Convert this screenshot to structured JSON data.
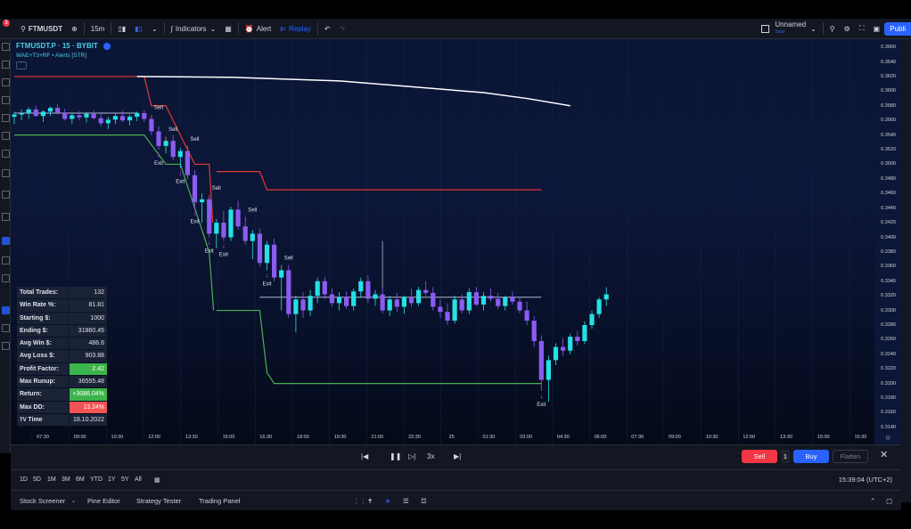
{
  "toolbar": {
    "notification_count": "3",
    "symbol": "FTMUSDT",
    "interval": "15m",
    "indicators_label": "Indicators",
    "alert_label": "Alert",
    "replay_label": "Replay",
    "layout_name": "Unnamed",
    "layout_status": "Save",
    "publish_label": "Publi"
  },
  "legend": {
    "title": "FTMUSDT.P · 15 · BYBIT",
    "indicator": "WAE+T3+RF • Alerts [STR]"
  },
  "colors": {
    "bull": "#26e0e6",
    "bear": "#8a5cf0",
    "upper_band": "#e53935",
    "lower_band": "#4caf50",
    "long_ma": "#ffffff",
    "signal": "#e040fb",
    "accent": "#2962ff"
  },
  "price_axis": [
    "0.3660",
    "0.3640",
    "0.3620",
    "0.3600",
    "0.3580",
    "0.3560",
    "0.3540",
    "0.3520",
    "0.3500",
    "0.3480",
    "0.3460",
    "0.3440",
    "0.3420",
    "0.3400",
    "0.3380",
    "0.3360",
    "0.3340",
    "0.3320",
    "0.3300",
    "0.3280",
    "0.3260",
    "0.3240",
    "0.3220",
    "0.3200",
    "0.3180",
    "0.3160",
    "0.3140"
  ],
  "time_axis": [
    "07:30",
    "09:00",
    "10:30",
    "12:00",
    "13:30",
    "15:00",
    "16:30",
    "18:00",
    "19:30",
    "21:00",
    "22:30",
    "25",
    "01:30",
    "03:00",
    "04:30",
    "06:00",
    "07:30",
    "09:00",
    "10:30",
    "12:00",
    "13:30",
    "15:00",
    "16:30"
  ],
  "chart_data": {
    "type": "candlestick",
    "ylim": [
      0.3135,
      0.3665
    ],
    "candles_note": "15m candles, open/high/low/close in USDT",
    "candles": [
      [
        0.3565,
        0.3572,
        0.3555,
        0.3568
      ],
      [
        0.3568,
        0.3575,
        0.356,
        0.357
      ],
      [
        0.357,
        0.3578,
        0.3562,
        0.3575
      ],
      [
        0.3575,
        0.358,
        0.3565,
        0.3566
      ],
      [
        0.3566,
        0.3574,
        0.3558,
        0.3572
      ],
      [
        0.3572,
        0.3579,
        0.3566,
        0.3577
      ],
      [
        0.3577,
        0.3582,
        0.3568,
        0.357
      ],
      [
        0.357,
        0.3576,
        0.356,
        0.3562
      ],
      [
        0.3562,
        0.357,
        0.3555,
        0.3567
      ],
      [
        0.3567,
        0.3573,
        0.356,
        0.3564
      ],
      [
        0.3564,
        0.3571,
        0.3557,
        0.3569
      ],
      [
        0.3569,
        0.3574,
        0.3561,
        0.3563
      ],
      [
        0.3563,
        0.357,
        0.3552,
        0.3556
      ],
      [
        0.3556,
        0.3565,
        0.3548,
        0.3561
      ],
      [
        0.3561,
        0.3569,
        0.3555,
        0.3566
      ],
      [
        0.3566,
        0.3573,
        0.3558,
        0.356
      ],
      [
        0.356,
        0.3568,
        0.3553,
        0.3565
      ],
      [
        0.3565,
        0.3572,
        0.3559,
        0.357
      ],
      [
        0.357,
        0.3574,
        0.3558,
        0.3562
      ],
      [
        0.3562,
        0.3568,
        0.354,
        0.3545
      ],
      [
        0.3545,
        0.3552,
        0.352,
        0.3525
      ],
      [
        0.3525,
        0.3538,
        0.3515,
        0.3532
      ],
      [
        0.3532,
        0.354,
        0.3505,
        0.351
      ],
      [
        0.351,
        0.3522,
        0.3495,
        0.3518
      ],
      [
        0.3518,
        0.3525,
        0.348,
        0.3485
      ],
      [
        0.3485,
        0.3492,
        0.344,
        0.3448
      ],
      [
        0.3448,
        0.346,
        0.342,
        0.3452
      ],
      [
        0.3452,
        0.3458,
        0.34,
        0.3405
      ],
      [
        0.3405,
        0.3425,
        0.3385,
        0.342
      ],
      [
        0.342,
        0.3436,
        0.3395,
        0.34
      ],
      [
        0.34,
        0.3442,
        0.3395,
        0.3438
      ],
      [
        0.3438,
        0.345,
        0.341,
        0.3415
      ],
      [
        0.3415,
        0.3428,
        0.339,
        0.3395
      ],
      [
        0.3395,
        0.341,
        0.337,
        0.3405
      ],
      [
        0.3405,
        0.3412,
        0.336,
        0.3365
      ],
      [
        0.3365,
        0.3395,
        0.3355,
        0.339
      ],
      [
        0.339,
        0.3398,
        0.334,
        0.3345
      ],
      [
        0.3345,
        0.3362,
        0.33,
        0.3355
      ],
      [
        0.3355,
        0.3362,
        0.329,
        0.3295
      ],
      [
        0.3295,
        0.332,
        0.327,
        0.3315
      ],
      [
        0.3315,
        0.3325,
        0.329,
        0.33
      ],
      [
        0.33,
        0.3328,
        0.3292,
        0.332
      ],
      [
        0.332,
        0.3345,
        0.331,
        0.334
      ],
      [
        0.334,
        0.3346,
        0.3315,
        0.3322
      ],
      [
        0.3322,
        0.333,
        0.3305,
        0.331
      ],
      [
        0.331,
        0.3325,
        0.33,
        0.3318
      ],
      [
        0.3318,
        0.3326,
        0.3302,
        0.3306
      ],
      [
        0.3306,
        0.333,
        0.33,
        0.3326
      ],
      [
        0.3326,
        0.3345,
        0.3318,
        0.334
      ],
      [
        0.334,
        0.3348,
        0.331,
        0.3316
      ],
      [
        0.3316,
        0.3328,
        0.3306,
        0.3322
      ],
      [
        0.3322,
        0.3331,
        0.3296,
        0.33
      ],
      [
        0.33,
        0.332,
        0.3292,
        0.3315
      ],
      [
        0.3315,
        0.3324,
        0.3298,
        0.3305
      ],
      [
        0.3305,
        0.332,
        0.3295,
        0.3318
      ],
      [
        0.3318,
        0.333,
        0.3305,
        0.331
      ],
      [
        0.331,
        0.3332,
        0.3306,
        0.3328
      ],
      [
        0.3328,
        0.334,
        0.332,
        0.3324
      ],
      [
        0.3324,
        0.3332,
        0.33,
        0.3305
      ],
      [
        0.3305,
        0.3315,
        0.329,
        0.3298
      ],
      [
        0.3298,
        0.331,
        0.328,
        0.3286
      ],
      [
        0.3286,
        0.332,
        0.3282,
        0.3315
      ],
      [
        0.3315,
        0.3322,
        0.3296,
        0.33
      ],
      [
        0.33,
        0.333,
        0.3295,
        0.3325
      ],
      [
        0.3325,
        0.3332,
        0.3306,
        0.3308
      ],
      [
        0.3308,
        0.3325,
        0.33,
        0.332
      ],
      [
        0.332,
        0.333,
        0.3312,
        0.3316
      ],
      [
        0.3316,
        0.3324,
        0.3302,
        0.3306
      ],
      [
        0.3306,
        0.332,
        0.33,
        0.3318
      ],
      [
        0.3318,
        0.3326,
        0.3308,
        0.3312
      ],
      [
        0.3312,
        0.3319,
        0.3296,
        0.33
      ],
      [
        0.33,
        0.3312,
        0.328,
        0.3286
      ],
      [
        0.3286,
        0.3292,
        0.325,
        0.3258
      ],
      [
        0.3258,
        0.3266,
        0.319,
        0.3205
      ],
      [
        0.3205,
        0.3238,
        0.3175,
        0.3232
      ],
      [
        0.3232,
        0.3255,
        0.3225,
        0.325
      ],
      [
        0.325,
        0.3262,
        0.3238,
        0.3245
      ],
      [
        0.3245,
        0.3268,
        0.324,
        0.3264
      ],
      [
        0.3264,
        0.3272,
        0.3252,
        0.3258
      ],
      [
        0.3258,
        0.3285,
        0.3254,
        0.328
      ],
      [
        0.328,
        0.33,
        0.3275,
        0.3295
      ],
      [
        0.3295,
        0.3318,
        0.329,
        0.3315
      ],
      [
        0.3315,
        0.3332,
        0.3306,
        0.3322
      ]
    ],
    "upper_band": [
      [
        0,
        0.362
      ],
      [
        18,
        0.362
      ],
      [
        19,
        0.358
      ],
      [
        21,
        0.358
      ],
      [
        25,
        0.35
      ],
      [
        27,
        0.35
      ],
      [
        27.5,
        0.342
      ],
      [
        27.6,
        null
      ],
      [
        28,
        0.349
      ],
      [
        34,
        0.349
      ],
      [
        35,
        0.3465
      ],
      [
        73,
        0.3465
      ]
    ],
    "lower_band": [
      [
        0,
        0.354
      ],
      [
        18,
        0.354
      ],
      [
        21,
        0.35
      ],
      [
        23,
        0.35
      ],
      [
        27,
        0.338
      ],
      [
        27.6,
        0.33
      ],
      [
        27.6,
        null
      ],
      [
        28,
        0.33
      ],
      [
        34,
        0.33
      ],
      [
        35,
        0.3215
      ],
      [
        36,
        0.32
      ],
      [
        73,
        0.32
      ]
    ],
    "long_ma": [
      [
        17,
        0.362
      ],
      [
        30,
        0.3619
      ],
      [
        45,
        0.3614
      ],
      [
        55,
        0.3606
      ],
      [
        65,
        0.3598
      ],
      [
        71,
        0.359
      ],
      [
        77,
        0.358
      ]
    ],
    "range_filter": [
      [
        0,
        0.357
      ],
      [
        17,
        0.357
      ]
    ],
    "range_filter_2": [
      [
        34,
        0.3318
      ],
      [
        73,
        0.3318
      ]
    ],
    "signals": [
      {
        "label": "Sell",
        "candle": 19,
        "type": "sell"
      },
      {
        "label": "Sell",
        "candle": 21,
        "type": "sell"
      },
      {
        "label": "Sell",
        "candle": 24,
        "type": "sell"
      },
      {
        "label": "Sell",
        "candle": 27,
        "type": "sell"
      },
      {
        "label": "Sell",
        "candle": 32,
        "type": "sell"
      },
      {
        "label": "Sell",
        "candle": 37,
        "type": "sell"
      },
      {
        "label": "Exit",
        "candle": 20,
        "type": "exit"
      },
      {
        "label": "Exit",
        "candle": 23,
        "type": "exit"
      },
      {
        "label": "Exit",
        "candle": 25,
        "type": "exit"
      },
      {
        "label": "Exit",
        "candle": 27,
        "type": "exit"
      },
      {
        "label": "Exit",
        "candle": 29,
        "type": "exit"
      },
      {
        "label": "Exit",
        "candle": 35,
        "type": "exit"
      },
      {
        "label": "Exit",
        "candle": 73,
        "type": "exit"
      }
    ]
  },
  "stats": [
    {
      "label": "Total Trades:",
      "value": "132",
      "style": ""
    },
    {
      "label": "Win Rate %:",
      "value": "81.81",
      "style": ""
    },
    {
      "label": "Starting $:",
      "value": "1000",
      "style": ""
    },
    {
      "label": "Ending $:",
      "value": "31860.45",
      "style": ""
    },
    {
      "label": "Avg Win $:",
      "value": "486.6",
      "style": ""
    },
    {
      "label": "Avg Loss $:",
      "value": "903.88",
      "style": ""
    },
    {
      "label": "Profit Factor:",
      "value": "2.42",
      "style": "green"
    },
    {
      "label": "Max Runup:",
      "value": "36555.48",
      "style": ""
    },
    {
      "label": "Return:",
      "value": "+3086.04%",
      "style": "green"
    },
    {
      "label": "Max DD:",
      "value": "13.24%",
      "style": "red"
    },
    {
      "label": "Time",
      "value": "18.10.2022",
      "style": ""
    }
  ],
  "replay": {
    "speed": "3x"
  },
  "trading": {
    "sell": "Sell",
    "qty": "1",
    "buy": "Buy",
    "flatten": "Flatten"
  },
  "ranges": [
    "1D",
    "5D",
    "1M",
    "3M",
    "6M",
    "YTD",
    "1Y",
    "5Y",
    "All"
  ],
  "clock": "15:39:04 (UTC+2)",
  "bottom_tabs": [
    "Stock Screener",
    "Pine Editor",
    "Strategy Tester",
    "Trading Panel"
  ]
}
